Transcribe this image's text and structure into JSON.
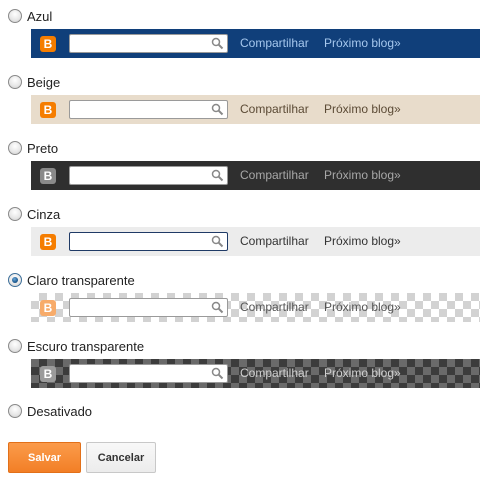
{
  "options": [
    {
      "id": "azul",
      "label": "Azul",
      "selected": false
    },
    {
      "id": "beige",
      "label": "Beige",
      "selected": false
    },
    {
      "id": "preto",
      "label": "Preto",
      "selected": false
    },
    {
      "id": "cinza",
      "label": "Cinza",
      "selected": false
    },
    {
      "id": "claro",
      "label": "Claro transparente",
      "selected": true
    },
    {
      "id": "escuro",
      "label": "Escuro transparente",
      "selected": false
    },
    {
      "id": "desativado",
      "label": "Desativado",
      "selected": false
    }
  ],
  "navbar": {
    "share_label": "Compartilhar",
    "next_label": "Próximo blog»",
    "logo_letter": "B",
    "search_icon": "magnifier-icon"
  },
  "buttons": {
    "save_label": "Salvar",
    "cancel_label": "Cancelar"
  },
  "colors": {
    "azul_bar": "#103f7a",
    "beige_bar": "#e8dccb",
    "preto_bar": "#2f2f2f",
    "cinza_bar": "#ececec",
    "save_button": "#f58220",
    "blogger_logo": "#f57d00"
  }
}
